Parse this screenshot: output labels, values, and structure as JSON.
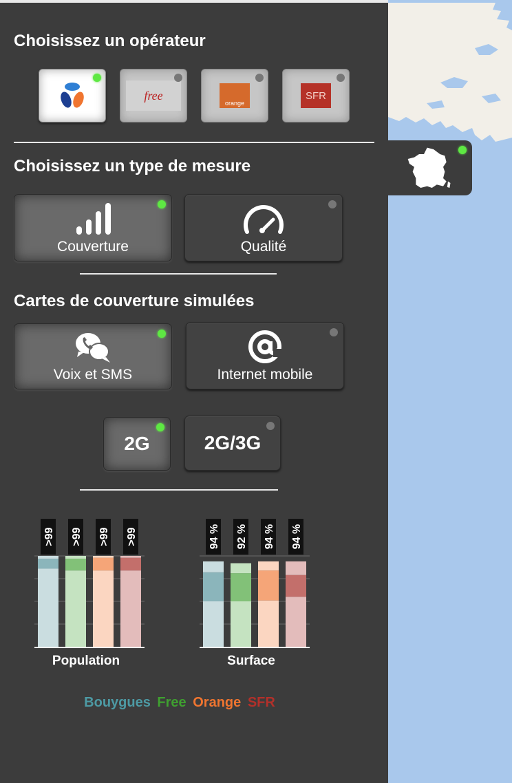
{
  "operators": {
    "heading": "Choisissez un opérateur",
    "items": [
      {
        "name": "Bouygues",
        "logo_text": "",
        "active": true
      },
      {
        "name": "Free",
        "logo_text": "free",
        "active": false
      },
      {
        "name": "Orange",
        "logo_text": "orange",
        "active": false
      },
      {
        "name": "SFR",
        "logo_text": "SFR",
        "active": false
      }
    ]
  },
  "measure": {
    "heading": "Choisissez un type de mesure",
    "coverage_label": "Couverture",
    "quality_label": "Qualité"
  },
  "simulated": {
    "heading": "Cartes de couverture simulées",
    "voice_label": "Voix et SMS",
    "internet_label": "Internet mobile"
  },
  "tech": {
    "g2_label": "2G",
    "g23_label": "2G/3G"
  },
  "chart_data": [
    {
      "type": "bar",
      "title": "Population",
      "categories": [
        "Bouygues",
        "Free",
        "Orange",
        "SFR"
      ],
      "data_labels": [
        ">99",
        ">99",
        ">99",
        ">99"
      ],
      "series": [
        {
          "values": [
            86,
            84,
            84,
            84
          ]
        },
        {
          "values": [
            11,
            13,
            14,
            14
          ]
        },
        {
          "values": [
            3,
            3,
            2,
            2
          ]
        }
      ],
      "ylim": [
        0,
        100
      ],
      "grid": true
    },
    {
      "type": "bar",
      "title": "Surface",
      "categories": [
        "Bouygues",
        "Free",
        "Orange",
        "SFR"
      ],
      "data_labels": [
        "94 %",
        "92 %",
        "94 %",
        "94 %"
      ],
      "series": [
        {
          "values": [
            50,
            50,
            51,
            55
          ]
        },
        {
          "values": [
            32,
            31,
            33,
            24
          ]
        },
        {
          "values": [
            12,
            11,
            10,
            15
          ]
        }
      ],
      "ylim": [
        0,
        100
      ],
      "grid": true
    }
  ],
  "legend": {
    "bouygues": "Bouygues",
    "free": "Free",
    "orange": "Orange",
    "sfr": "SFR"
  },
  "colors": {
    "bouygues": "#4d8d96",
    "free": "#3fa030",
    "orange": "#f07530",
    "sfr": "#a3211b",
    "led_on": "#5ee843",
    "panel": "#3c3c3c",
    "sea": "#a9c8ec"
  },
  "icons": {
    "coverage": "signal-bars-icon",
    "quality": "gauge-icon",
    "voice": "chat-phone-icon",
    "internet": "at-sign-icon",
    "france": "france-map-icon"
  }
}
